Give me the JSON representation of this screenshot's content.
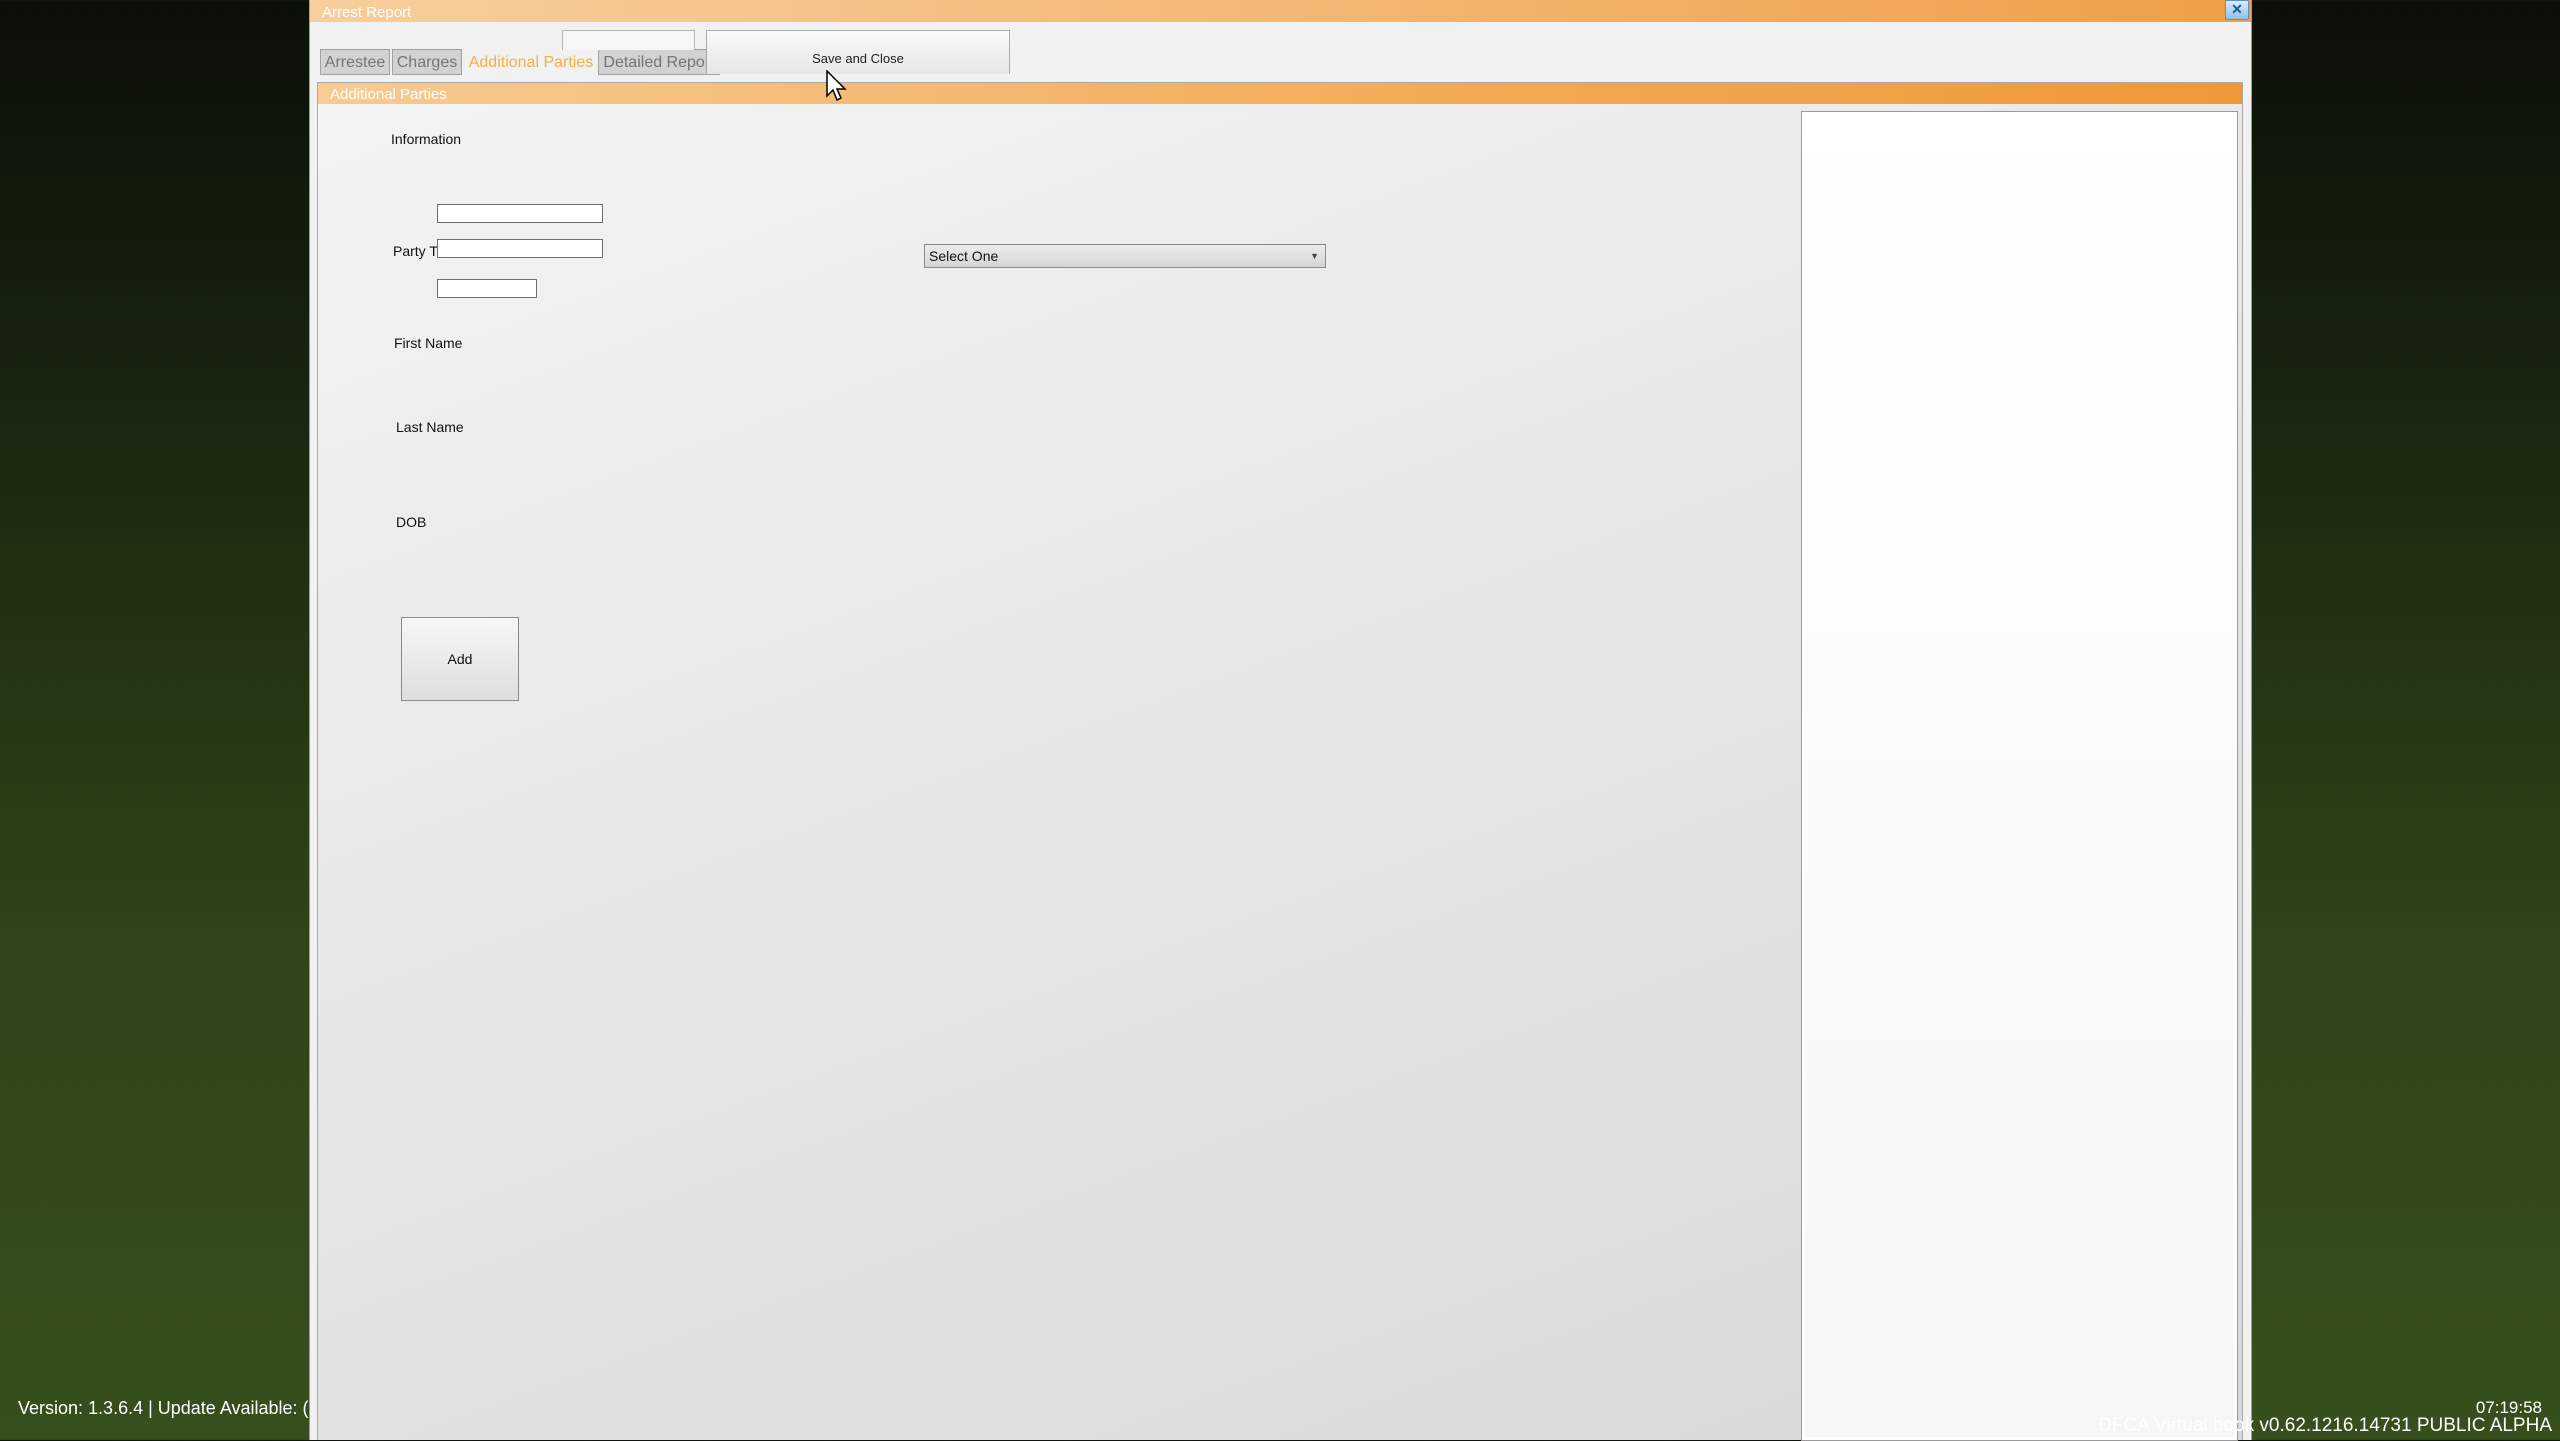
{
  "window": {
    "title": "Arrest Report",
    "close_label": "✕"
  },
  "tabs": [
    {
      "label": "Arrestee"
    },
    {
      "label": "Charges"
    },
    {
      "label": "Additional Parties"
    },
    {
      "label": "Detailed Report"
    }
  ],
  "toolbar": {
    "save_label": "Save and Close"
  },
  "section": {
    "header": "Additional Parties"
  },
  "form": {
    "information_label": "Information",
    "party_type_label": "Party T",
    "party_type_select": "Select One",
    "first_name_label": "First Name",
    "last_name_label": "Last Name",
    "dob_label": "DOB",
    "add_label": "Add"
  },
  "status": {
    "version": "Version: 1.3.6.4 | Update Available: (",
    "time": "07:19:58",
    "build": "DFCA Virtual book v0.62.1216.14731 PUBLIC ALPHA"
  },
  "colors": {
    "accent": "#f3a954",
    "active_tab": "#f0b04c"
  }
}
